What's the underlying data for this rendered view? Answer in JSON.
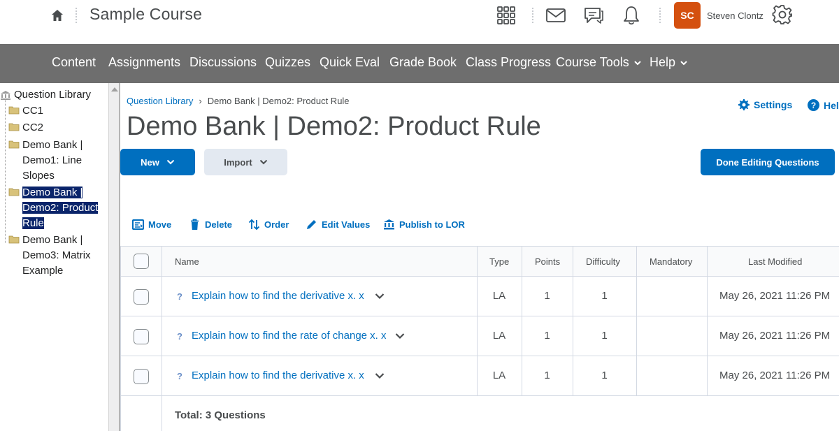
{
  "header": {
    "course_title": "Sample Course",
    "user_initials": "SC",
    "user_name": "Steven Clontz",
    "avatar_color": "#d4500f"
  },
  "nav": {
    "items": [
      {
        "label": "Content"
      },
      {
        "label": "Assignments"
      },
      {
        "label": "Discussions"
      },
      {
        "label": "Quizzes"
      },
      {
        "label": "Quick Eval"
      },
      {
        "label": "Grade Book"
      },
      {
        "label": "Class Progress"
      },
      {
        "label": "Course Tools",
        "dropdown": true
      },
      {
        "label": "Help",
        "dropdown": true
      }
    ]
  },
  "tree": {
    "root": "Question Library",
    "nodes": [
      {
        "lines": [
          "CC1"
        ]
      },
      {
        "lines": [
          "CC2"
        ]
      },
      {
        "lines": [
          "Demo Bank |",
          "Demo1: Line",
          "Slopes"
        ]
      },
      {
        "lines": [
          "Demo Bank |",
          "Demo2: Product",
          "Rule"
        ],
        "selected": true
      },
      {
        "lines": [
          "Demo Bank |",
          "Demo3: Matrix",
          "Example"
        ]
      }
    ]
  },
  "breadcrumb": {
    "root": "Question Library",
    "separator": "›",
    "current": "Demo Bank | Demo2: Product Rule"
  },
  "page_title": "Demo Bank | Demo2: Product Rule",
  "links": {
    "settings": "Settings",
    "help": "Help"
  },
  "buttons": {
    "new": "New",
    "import": "Import",
    "done": "Done Editing Questions"
  },
  "actions": {
    "move": "Move",
    "delete": "Delete",
    "order": "Order",
    "edit_values": "Edit Values",
    "publish": "Publish to LOR"
  },
  "table": {
    "columns": {
      "name": "Name",
      "type": "Type",
      "points": "Points",
      "difficulty": "Difficulty",
      "mandatory": "Mandatory",
      "last_modified": "Last Modified"
    },
    "rows": [
      {
        "name": "Explain how to find the derivative x. x",
        "type": "LA",
        "points": "1",
        "difficulty": "1",
        "mandatory": "",
        "last_modified": "May 26, 2021 11:26 PM"
      },
      {
        "name": "Explain how to find the rate of change x. x",
        "type": "LA",
        "points": "1",
        "difficulty": "1",
        "mandatory": "",
        "last_modified": "May 26, 2021 11:26 PM"
      },
      {
        "name": "Explain how to find the derivative x. x",
        "type": "LA",
        "points": "1",
        "difficulty": "1",
        "mandatory": "",
        "last_modified": "May 26, 2021 11:26 PM"
      }
    ],
    "total": "Total:  3 Questions"
  },
  "colors": {
    "primary": "#006fbf",
    "navbar": "#6e6e6e",
    "text": "#494c4e"
  }
}
